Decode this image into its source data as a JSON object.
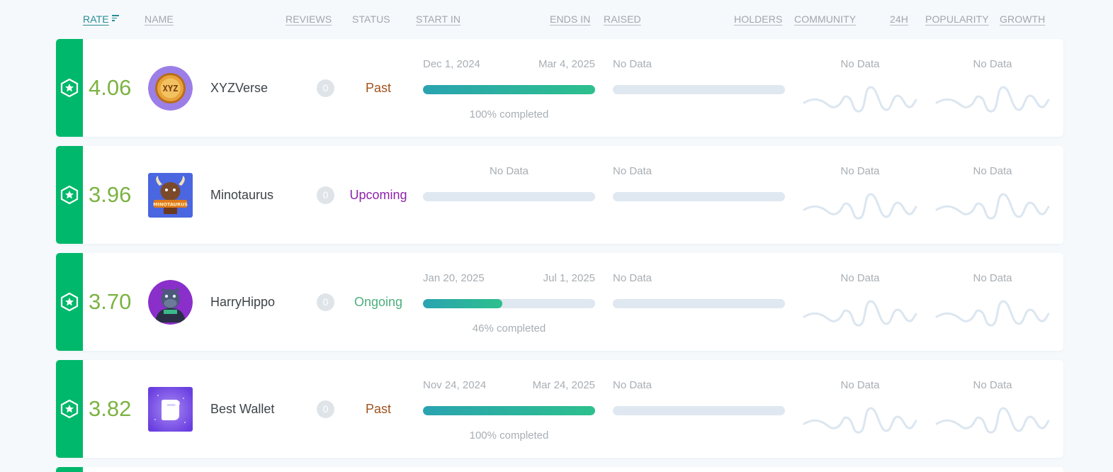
{
  "header": {
    "rate": "RATE",
    "name": "NAME",
    "reviews": "REVIEWS",
    "status": "STATUS",
    "start_in": "START IN",
    "ends_in": "ENDS IN",
    "raised": "RAISED",
    "holders": "HOLDERS",
    "community": "COMMUNITY",
    "h24": "24H",
    "popularity": "POPULARITY",
    "growth": "GROWTH"
  },
  "colors": {
    "accent_green": "#00b86b",
    "rate_green": "#7cb342",
    "status_past": "#a0521d",
    "status_upcoming": "#8e24aa",
    "status_ongoing": "#4caf7d",
    "header_active": "#2a8c94"
  },
  "rows": [
    {
      "rate": "4.06",
      "name": "XYZVerse",
      "logo": "xyzverse-logo",
      "reviews": "0",
      "status": "Past",
      "start": "Dec 1, 2024",
      "end": "Mar 4, 2025",
      "progress": 1.0,
      "completed": "100% completed",
      "raised": "No Data",
      "community": "No Data",
      "growth": "No Data"
    },
    {
      "rate": "3.96",
      "name": "Minotaurus",
      "logo": "minotaurus-logo",
      "reviews": "0",
      "status": "Upcoming",
      "dates": "No Data",
      "progress": 0,
      "raised": "No Data",
      "community": "No Data",
      "growth": "No Data"
    },
    {
      "rate": "3.70",
      "name": "HarryHippo",
      "logo": "harryhippo-logo",
      "reviews": "0",
      "status": "Ongoing",
      "start": "Jan 20, 2025",
      "end": "Jul 1, 2025",
      "progress": 0.46,
      "completed": "46% completed",
      "raised": "No Data",
      "community": "No Data",
      "growth": "No Data"
    },
    {
      "rate": "3.82",
      "name": "Best Wallet",
      "logo": "bestwallet-logo",
      "reviews": "0",
      "status": "Past",
      "start": "Nov 24, 2024",
      "end": "Mar 24, 2025",
      "progress": 1.0,
      "completed": "100% completed",
      "raised": "No Data",
      "community": "No Data",
      "growth": "No Data"
    }
  ]
}
